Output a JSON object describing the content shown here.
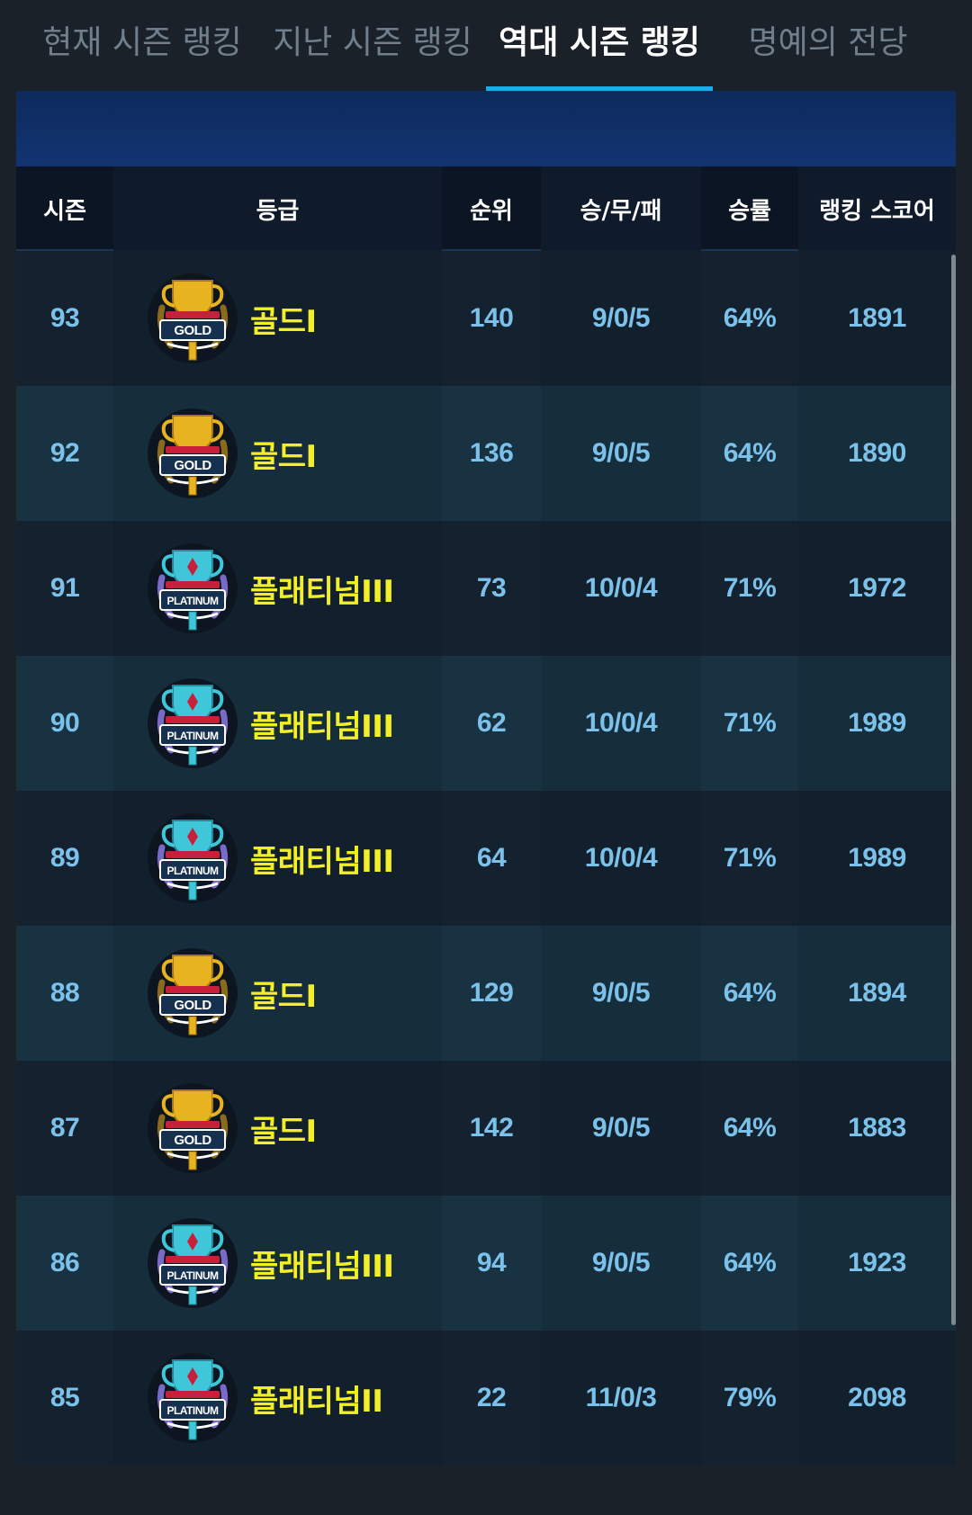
{
  "tabs": [
    {
      "label": "현재 시즌 랭킹",
      "active": false
    },
    {
      "label": "지난 시즌 랭킹",
      "active": false
    },
    {
      "label": "역대 시즌 랭킹",
      "active": true
    },
    {
      "label": "명예의 전당",
      "active": false
    }
  ],
  "table": {
    "headers": [
      "시즌",
      "등급",
      "순위",
      "승/무/패",
      "승률",
      "랭킹 스코어"
    ],
    "rows": [
      {
        "season": "93",
        "badge": "gold",
        "badge_text": "GOLD",
        "tier": "골드I",
        "rank": "140",
        "record": "9/0/5",
        "winrate": "64%",
        "score": "1891"
      },
      {
        "season": "92",
        "badge": "gold",
        "badge_text": "GOLD",
        "tier": "골드I",
        "rank": "136",
        "record": "9/0/5",
        "winrate": "64%",
        "score": "1890"
      },
      {
        "season": "91",
        "badge": "platinum",
        "badge_text": "PLATINUM",
        "tier": "플래티넘III",
        "rank": "73",
        "record": "10/0/4",
        "winrate": "71%",
        "score": "1972"
      },
      {
        "season": "90",
        "badge": "platinum",
        "badge_text": "PLATINUM",
        "tier": "플래티넘III",
        "rank": "62",
        "record": "10/0/4",
        "winrate": "71%",
        "score": "1989"
      },
      {
        "season": "89",
        "badge": "platinum",
        "badge_text": "PLATINUM",
        "tier": "플래티넘III",
        "rank": "64",
        "record": "10/0/4",
        "winrate": "71%",
        "score": "1989"
      },
      {
        "season": "88",
        "badge": "gold",
        "badge_text": "GOLD",
        "tier": "골드I",
        "rank": "129",
        "record": "9/0/5",
        "winrate": "64%",
        "score": "1894"
      },
      {
        "season": "87",
        "badge": "gold",
        "badge_text": "GOLD",
        "tier": "골드I",
        "rank": "142",
        "record": "9/0/5",
        "winrate": "64%",
        "score": "1883"
      },
      {
        "season": "86",
        "badge": "platinum",
        "badge_text": "PLATINUM",
        "tier": "플래티넘III",
        "rank": "94",
        "record": "9/0/5",
        "winrate": "64%",
        "score": "1923"
      },
      {
        "season": "85",
        "badge": "platinum",
        "badge_text": "PLATINUM",
        "tier": "플래티넘II",
        "rank": "22",
        "record": "11/0/3",
        "winrate": "79%",
        "score": "2098"
      }
    ]
  },
  "colors": {
    "accent": "#21a8e8",
    "tier_text": "#f2ee28",
    "value_text": "#7cc1ea",
    "gold": "#e8b321",
    "platinum": "#3fc6d8"
  },
  "icons": {
    "gold": "gold-trophy-badge-icon",
    "platinum": "platinum-trophy-badge-icon"
  }
}
